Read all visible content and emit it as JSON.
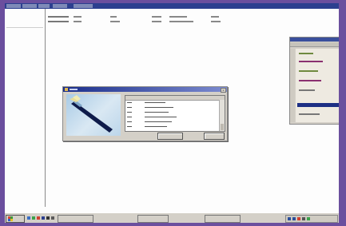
{
  "topbar": {
    "tabs": [
      "",
      "",
      "",
      "",
      ""
    ]
  },
  "columns": [
    "",
    "",
    "",
    "",
    "",
    ""
  ],
  "left_rows": [
    "",
    "",
    ""
  ],
  "dialog": {
    "title": "",
    "columns": [
      "",
      "",
      ""
    ],
    "rows": [
      {
        "c1": "",
        "c2": "",
        "c3": ""
      },
      {
        "c1": "",
        "c2": "",
        "c3": ""
      },
      {
        "c1": "",
        "c2": "",
        "c3": ""
      },
      {
        "c1": "",
        "c2": "",
        "c3": ""
      },
      {
        "c1": "",
        "c2": "",
        "c3": ""
      },
      {
        "c1": "",
        "c2": "",
        "c3": ""
      }
    ],
    "buttons": {
      "primary": "",
      "secondary": ""
    }
  },
  "right_window": {
    "items": [
      "",
      "",
      "",
      "",
      "",
      ""
    ],
    "selected": ""
  },
  "taskbar": {
    "start_label": "",
    "tasks": [
      "",
      "",
      ""
    ],
    "clock": ""
  },
  "colors": {
    "desktop_bg": "#6b4f9e",
    "titlebar_start": "#1b2f8c",
    "titlebar_end": "#7c8bd0",
    "window_face": "#d4d0c8",
    "selection": "#1d2f84"
  },
  "icons": [
    "close-icon",
    "app-icon",
    "scroll-arrow-icon",
    "start-logo-icon"
  ]
}
